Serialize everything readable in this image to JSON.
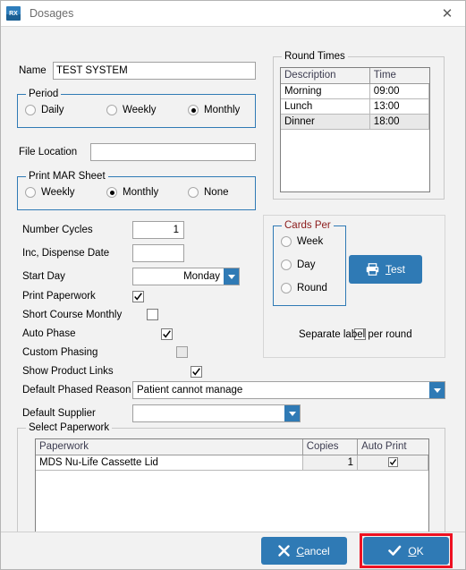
{
  "window": {
    "title": "Dosages",
    "icon": "rx-icon",
    "icon_text": "RX",
    "close_label": "✕"
  },
  "form": {
    "name_label": "Name",
    "name_value": "TEST SYSTEM",
    "name_placeholder": "",
    "file_location_label": "File Location",
    "file_location_value": "",
    "period": {
      "legend": "Period",
      "options": [
        {
          "label": "Daily",
          "selected": false
        },
        {
          "label": "Weekly",
          "selected": false
        },
        {
          "label": "Monthly",
          "selected": true
        }
      ]
    },
    "print_mar": {
      "legend": "Print MAR Sheet",
      "options": [
        {
          "label": "Weekly",
          "selected": false
        },
        {
          "label": "Monthly",
          "selected": true
        },
        {
          "label": "None",
          "selected": false
        }
      ]
    },
    "number_cycles_label": "Number Cycles",
    "number_cycles_value": "1",
    "inc_dispense_date_label": "Inc, Dispense Date",
    "inc_dispense_date_value": "",
    "start_day_label": "Start Day",
    "start_day_value": "Monday",
    "checkboxes": [
      {
        "label": "Print Paperwork",
        "checked": true,
        "disabled": false
      },
      {
        "label": "Short Course Monthly",
        "checked": false,
        "disabled": false
      },
      {
        "label": "Auto Phase",
        "checked": true,
        "disabled": false
      },
      {
        "label": "Custom Phasing",
        "checked": false,
        "disabled": true
      },
      {
        "label": "Show Product Links",
        "checked": true,
        "disabled": false
      }
    ],
    "default_phased_reason_label": "Default Phased Reason",
    "default_phased_reason_value": "Patient cannot manage",
    "default_supplier_label": "Default Supplier",
    "default_supplier_value": ""
  },
  "round_times": {
    "legend": "Round Times",
    "columns": [
      "Description",
      "Time"
    ],
    "rows": [
      {
        "description": "Morning",
        "time": "09:00",
        "selected": false
      },
      {
        "description": "Lunch",
        "time": "13:00",
        "selected": false
      },
      {
        "description": "Dinner",
        "time": "18:00",
        "selected": true
      }
    ]
  },
  "cards_per": {
    "legend": "Cards Per",
    "legend_color": "#8b1a1a",
    "options": [
      {
        "label": "Week",
        "selected": false
      },
      {
        "label": "Day",
        "selected": false
      },
      {
        "label": "Round",
        "selected": false
      }
    ],
    "test_button": "Test",
    "separate_label": "Separate label per round",
    "separate_checked": false
  },
  "select_paperwork": {
    "legend": "Select Paperwork",
    "columns": [
      "Paperwork",
      "Copies",
      "Auto Print"
    ],
    "rows": [
      {
        "paperwork": "MDS Nu-Life Cassette Lid",
        "copies": "1",
        "auto_print": true
      }
    ]
  },
  "footer": {
    "cancel_label": "Cancel",
    "ok_label": "OK"
  },
  "colors": {
    "accent": "#2f7ab5",
    "group_border": "#2f7ab5",
    "highlight": "#ee1122",
    "cards_per_legend": "#8b1a1a",
    "window_bg": "#f2f2f2"
  }
}
